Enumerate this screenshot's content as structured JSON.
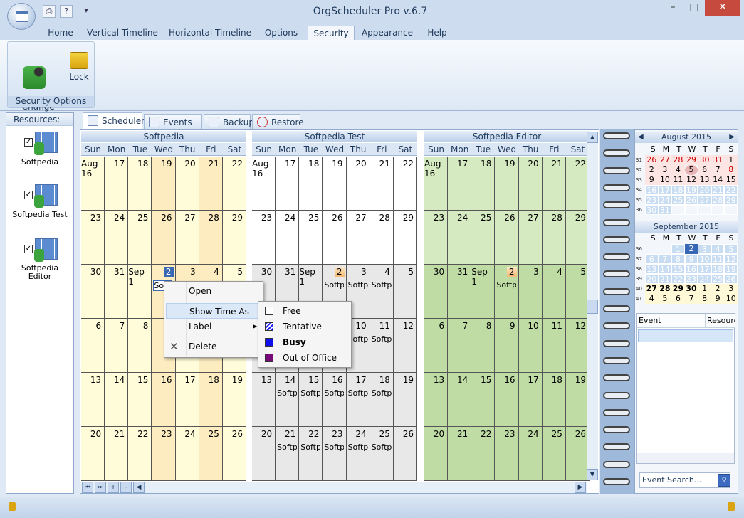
{
  "app": {
    "title": "OrgScheduler Pro v.6.7"
  },
  "quick_access": {
    "print_icon": "print-icon",
    "help_label": "?",
    "more_label": "▾"
  },
  "window_controls": {
    "minimize": "–",
    "maximize": "□",
    "close": "✕"
  },
  "ribbon_tabs": [
    "Home",
    "Vertical Timeline",
    "Horizontal Timeline",
    "Options",
    "Security",
    "Appearance",
    "Help"
  ],
  "ribbon": {
    "change_password": "Change\nPassword",
    "lock": "Lock",
    "group_label": "Security Options"
  },
  "resources": {
    "header": "Resources:",
    "items": [
      "Softpedia",
      "Softpedia Test",
      "Softpedia\nEditor"
    ]
  },
  "content_tabs": [
    "Scheduler",
    "Events List",
    "Backup",
    "Restore"
  ],
  "calendar": {
    "dows": [
      "Sun",
      "Mon",
      "Tue",
      "Wed",
      "Thu",
      "Fri",
      "Sat"
    ],
    "schedulers": [
      {
        "name": "Softpedia",
        "weeks": [
          [
            "Aug 16",
            "17",
            "18",
            "19",
            "20",
            "21",
            "22"
          ],
          [
            "23",
            "24",
            "25",
            "26",
            "27",
            "28",
            "29"
          ],
          [
            "30",
            "31",
            "Sep 1",
            "2",
            "3",
            "4",
            "5"
          ],
          [
            "6",
            "7",
            "8",
            "9",
            "10",
            "11",
            "12"
          ],
          [
            "13",
            "14",
            "15",
            "16",
            "17",
            "18",
            "19"
          ],
          [
            "20",
            "21",
            "22",
            "23",
            "24",
            "25",
            "26"
          ]
        ],
        "events": {
          "2-3": "Softpedia"
        }
      },
      {
        "name": "Softpedia Test",
        "weeks": [
          [
            "Aug 16",
            "17",
            "18",
            "19",
            "20",
            "21",
            "22"
          ],
          [
            "23",
            "24",
            "25",
            "26",
            "27",
            "28",
            "29"
          ],
          [
            "30",
            "31",
            "Sep 1",
            "2",
            "3",
            "4",
            "5"
          ],
          [
            "6",
            "7",
            "8",
            "9",
            "10",
            "11",
            "12"
          ],
          [
            "13",
            "14",
            "15",
            "16",
            "17",
            "18",
            "19"
          ],
          [
            "20",
            "21",
            "22",
            "23",
            "24",
            "25",
            "26"
          ]
        ],
        "events": {
          "2-3": "Softpedia",
          "2-4": "Softpedia",
          "2-5": "Softpedia",
          "3-4": "Softpedia",
          "3-5": "Softpedia",
          "4-1": "Softpedia",
          "4-2": "Softpedia",
          "4-3": "Softpedia",
          "4-4": "Softpedia",
          "4-5": "Softpedia",
          "5-1": "Softpedia",
          "5-2": "Softpedia",
          "5-3": "Softpedia",
          "5-4": "Softpedia",
          "5-5": "Softpedia"
        }
      },
      {
        "name": "Softpedia Editor",
        "weeks": [
          [
            "Aug 16",
            "17",
            "18",
            "19",
            "20",
            "21",
            "22"
          ],
          [
            "23",
            "24",
            "25",
            "26",
            "27",
            "28",
            "29"
          ],
          [
            "30",
            "31",
            "Sep 1",
            "2",
            "3",
            "4",
            "5"
          ],
          [
            "6",
            "7",
            "8",
            "9",
            "10",
            "11",
            "12"
          ],
          [
            "13",
            "14",
            "15",
            "16",
            "17",
            "18",
            "19"
          ],
          [
            "20",
            "21",
            "22",
            "23",
            "24",
            "25",
            "26"
          ]
        ],
        "events": {
          "2-3": "Softpedia"
        }
      }
    ]
  },
  "context_menu": {
    "items": [
      "Open",
      "Show Time As",
      "Label",
      "Delete"
    ]
  },
  "show_time_as": {
    "items": [
      "Free",
      "Tentative",
      "Busy",
      "Out of Office"
    ],
    "colors": [
      "#ffffff",
      "#1a1aff",
      "#1010ee",
      "#7a0a7a"
    ]
  },
  "mini_calendars": {
    "dows": [
      "S",
      "M",
      "T",
      "W",
      "T",
      "F",
      "S"
    ],
    "august": {
      "title": "August 2015",
      "weeks": [
        "31",
        "32",
        "33",
        "34",
        "35",
        "36"
      ],
      "days": [
        [
          "26",
          "27",
          "28",
          "29",
          "30",
          "31",
          "1"
        ],
        [
          "2",
          "3",
          "4",
          "5",
          "6",
          "7",
          "8"
        ],
        [
          "9",
          "10",
          "11",
          "12",
          "13",
          "14",
          "15"
        ],
        [
          "16",
          "17",
          "18",
          "19",
          "20",
          "21",
          "22"
        ],
        [
          "23",
          "24",
          "25",
          "26",
          "27",
          "28",
          "29"
        ],
        [
          "30",
          "31",
          "",
          "",
          "",
          "",
          ""
        ]
      ]
    },
    "september": {
      "title": "September 2015",
      "weeks": [
        "36",
        "37",
        "38",
        "39",
        "40",
        "41"
      ],
      "days": [
        [
          "",
          "",
          "1",
          "2",
          "3",
          "4",
          "5"
        ],
        [
          "6",
          "7",
          "8",
          "9",
          "10",
          "11",
          "12"
        ],
        [
          "13",
          "14",
          "15",
          "16",
          "17",
          "18",
          "19"
        ],
        [
          "20",
          "21",
          "22",
          "23",
          "24",
          "25",
          "26"
        ],
        [
          "27",
          "28",
          "29",
          "30",
          "1",
          "2",
          "3"
        ],
        [
          "4",
          "5",
          "6",
          "7",
          "8",
          "9",
          "10"
        ]
      ]
    }
  },
  "event_table": {
    "columns": [
      "Event",
      "Resource"
    ]
  },
  "search": {
    "placeholder": "Event Search..."
  }
}
